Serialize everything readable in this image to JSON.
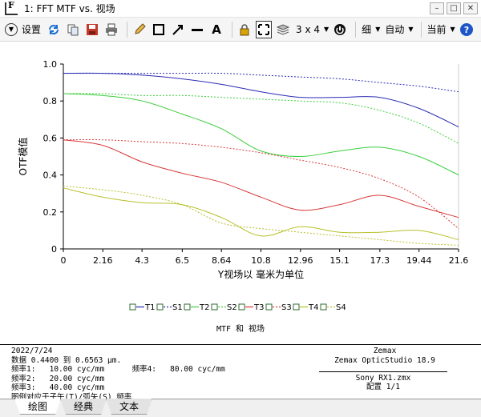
{
  "window": {
    "title": "1: FFT MTF vs. 视场",
    "app_icon_letter": "F"
  },
  "toolbar": {
    "settings_label": "设置",
    "layout_label": "3 x 4",
    "line_label": "细",
    "scale_label": "自动",
    "current_label": "当前"
  },
  "chart_data": {
    "type": "line",
    "xlabel": "Y视场以 毫米为单位",
    "ylabel": "OTF模值",
    "xlim": [
      0,
      21.6
    ],
    "ylim": [
      0,
      1.0
    ],
    "x_ticks": [
      "0",
      "2.16",
      "4.3",
      "6.5",
      "8.64",
      "10.8",
      "12.96",
      "15.1",
      "17.3",
      "19.44",
      "21.6"
    ],
    "y_ticks": [
      "0",
      "0.2",
      "0.4",
      "0.6",
      "0.8",
      "1.0"
    ],
    "caption": "MTF 和 视场",
    "series": [
      {
        "name": "T1",
        "color": "#2a2ab4",
        "dash": false,
        "x": [
          0,
          2.16,
          4.32,
          6.48,
          8.64,
          10.8,
          12.96,
          15.12,
          17.28,
          19.44,
          21.6
        ],
        "y": [
          0.95,
          0.95,
          0.94,
          0.92,
          0.89,
          0.85,
          0.82,
          0.82,
          0.82,
          0.76,
          0.66
        ]
      },
      {
        "name": "S1",
        "color": "#2a2ab4",
        "dash": true,
        "x": [
          0,
          2.16,
          4.32,
          6.48,
          8.64,
          10.8,
          12.96,
          15.12,
          17.28,
          19.44,
          21.6
        ],
        "y": [
          0.95,
          0.95,
          0.95,
          0.95,
          0.95,
          0.94,
          0.93,
          0.92,
          0.9,
          0.88,
          0.85
        ]
      },
      {
        "name": "T2",
        "color": "#3ccf3c",
        "dash": false,
        "x": [
          0,
          2.16,
          4.32,
          6.48,
          8.64,
          10.8,
          12.96,
          15.12,
          17.28,
          19.44,
          21.6
        ],
        "y": [
          0.84,
          0.83,
          0.8,
          0.73,
          0.65,
          0.53,
          0.5,
          0.53,
          0.55,
          0.5,
          0.4
        ]
      },
      {
        "name": "S2",
        "color": "#3ccf3c",
        "dash": true,
        "x": [
          0,
          2.16,
          4.32,
          6.48,
          8.64,
          10.8,
          12.96,
          15.12,
          17.28,
          19.44,
          21.6
        ],
        "y": [
          0.84,
          0.84,
          0.83,
          0.83,
          0.82,
          0.81,
          0.8,
          0.79,
          0.75,
          0.68,
          0.57
        ]
      },
      {
        "name": "T3",
        "color": "#d83a3a",
        "dash": false,
        "x": [
          0,
          2.16,
          4.32,
          6.48,
          8.64,
          10.8,
          12.96,
          15.12,
          17.28,
          19.44,
          21.6
        ],
        "y": [
          0.59,
          0.56,
          0.47,
          0.41,
          0.36,
          0.28,
          0.21,
          0.24,
          0.29,
          0.23,
          0.17
        ]
      },
      {
        "name": "S3",
        "color": "#d83a3a",
        "dash": true,
        "x": [
          0,
          2.16,
          4.32,
          6.48,
          8.64,
          10.8,
          12.96,
          15.12,
          17.28,
          19.44,
          21.6
        ],
        "y": [
          0.59,
          0.59,
          0.58,
          0.57,
          0.55,
          0.52,
          0.48,
          0.44,
          0.38,
          0.28,
          0.11
        ]
      },
      {
        "name": "T4",
        "color": "#b8c02a",
        "dash": false,
        "x": [
          0,
          2.16,
          4.32,
          6.48,
          8.64,
          10.8,
          12.96,
          15.12,
          17.28,
          19.44,
          21.6
        ],
        "y": [
          0.33,
          0.28,
          0.25,
          0.24,
          0.17,
          0.07,
          0.12,
          0.09,
          0.09,
          0.1,
          0.05
        ]
      },
      {
        "name": "S4",
        "color": "#b8c02a",
        "dash": true,
        "x": [
          0,
          2.16,
          4.32,
          6.48,
          8.64,
          10.8,
          12.96,
          15.12,
          17.28,
          19.44,
          21.6
        ],
        "y": [
          0.34,
          0.32,
          0.29,
          0.24,
          0.14,
          0.11,
          0.09,
          0.07,
          0.05,
          0.03,
          0.02
        ]
      }
    ]
  },
  "info": {
    "date": "2022/7/24",
    "data_range": "数据 0.4400 到 0.6563 μm.",
    "freq1": "频率1:   10.00 cyc/mm",
    "freq4": "频率4:   80.00 cyc/mm",
    "freq2": "频率2:   20.00 cyc/mm",
    "freq3": "频率3:   40.00 cyc/mm",
    "legend_note": "图例对应于子午(T)/弧矢(S) 频率",
    "company": "Zemax",
    "product": "Zemax OpticStudio 18.9",
    "file": "Sony RX1.zmx",
    "config": "配置 1/1"
  },
  "tabs": [
    "绘图",
    "经典",
    "文本"
  ]
}
